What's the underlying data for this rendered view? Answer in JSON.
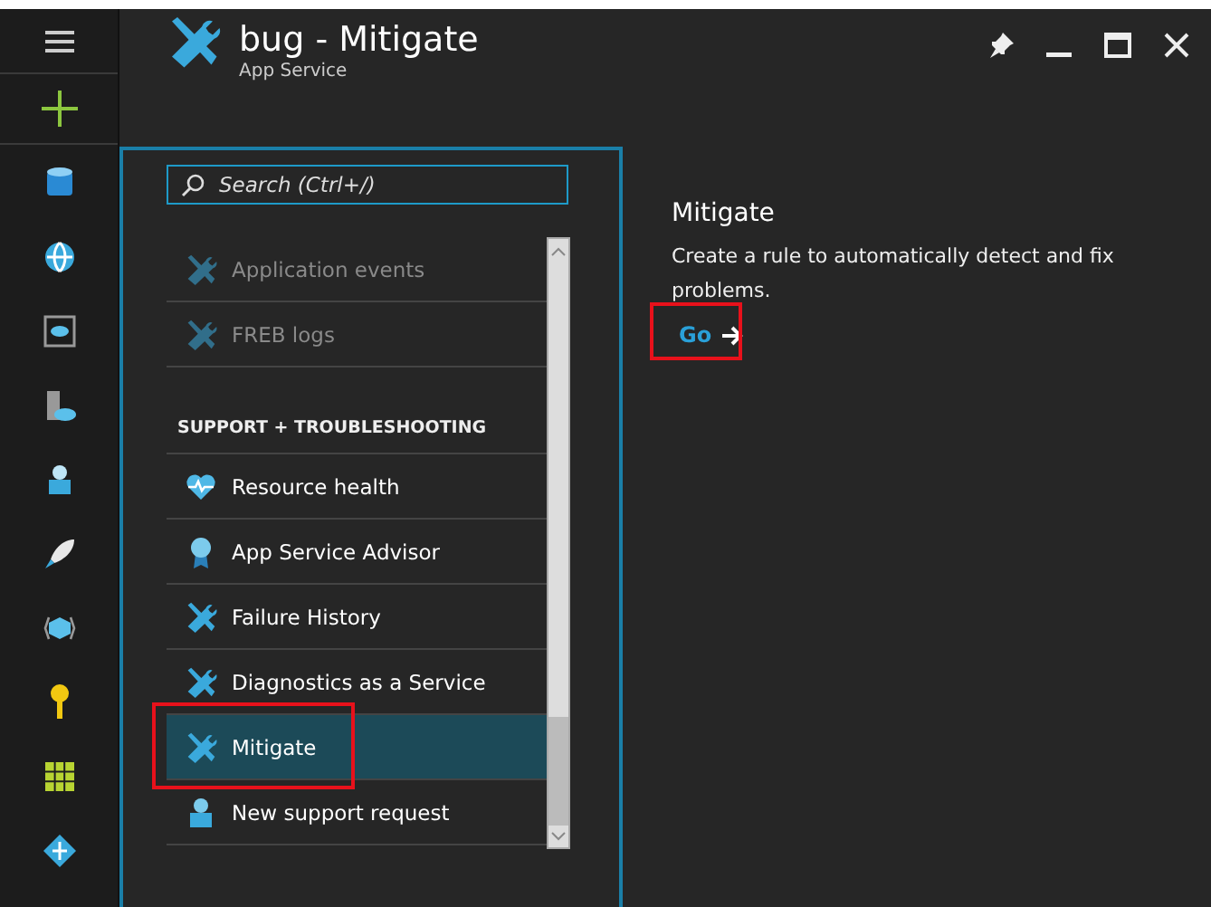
{
  "header": {
    "title": "bug - Mitigate",
    "subtitle": "App Service"
  },
  "search": {
    "placeholder": "Search (Ctrl+/)"
  },
  "menu": [
    {
      "kind": "item",
      "label": "Application events",
      "disabled": true,
      "selected": false,
      "highlighted": false
    },
    {
      "kind": "item",
      "label": "FREB logs",
      "disabled": true,
      "selected": false,
      "highlighted": false
    },
    {
      "kind": "header",
      "label": "SUPPORT + TROUBLESHOOTING"
    },
    {
      "kind": "item",
      "label": "Resource health",
      "disabled": false,
      "selected": false,
      "highlighted": false
    },
    {
      "kind": "item",
      "label": "App Service Advisor",
      "disabled": false,
      "selected": false,
      "highlighted": false
    },
    {
      "kind": "item",
      "label": "Failure History",
      "disabled": false,
      "selected": false,
      "highlighted": false
    },
    {
      "kind": "item",
      "label": "Diagnostics as a Service",
      "disabled": false,
      "selected": false,
      "highlighted": false
    },
    {
      "kind": "item",
      "label": "Mitigate",
      "disabled": false,
      "selected": true,
      "highlighted": true
    },
    {
      "kind": "item",
      "label": "New support request",
      "disabled": false,
      "selected": false,
      "highlighted": false
    }
  ],
  "detail": {
    "title": "Mitigate",
    "description": "Create a rule to automatically detect and fix problems.",
    "link": {
      "label": "Go",
      "highlighted": true
    }
  }
}
